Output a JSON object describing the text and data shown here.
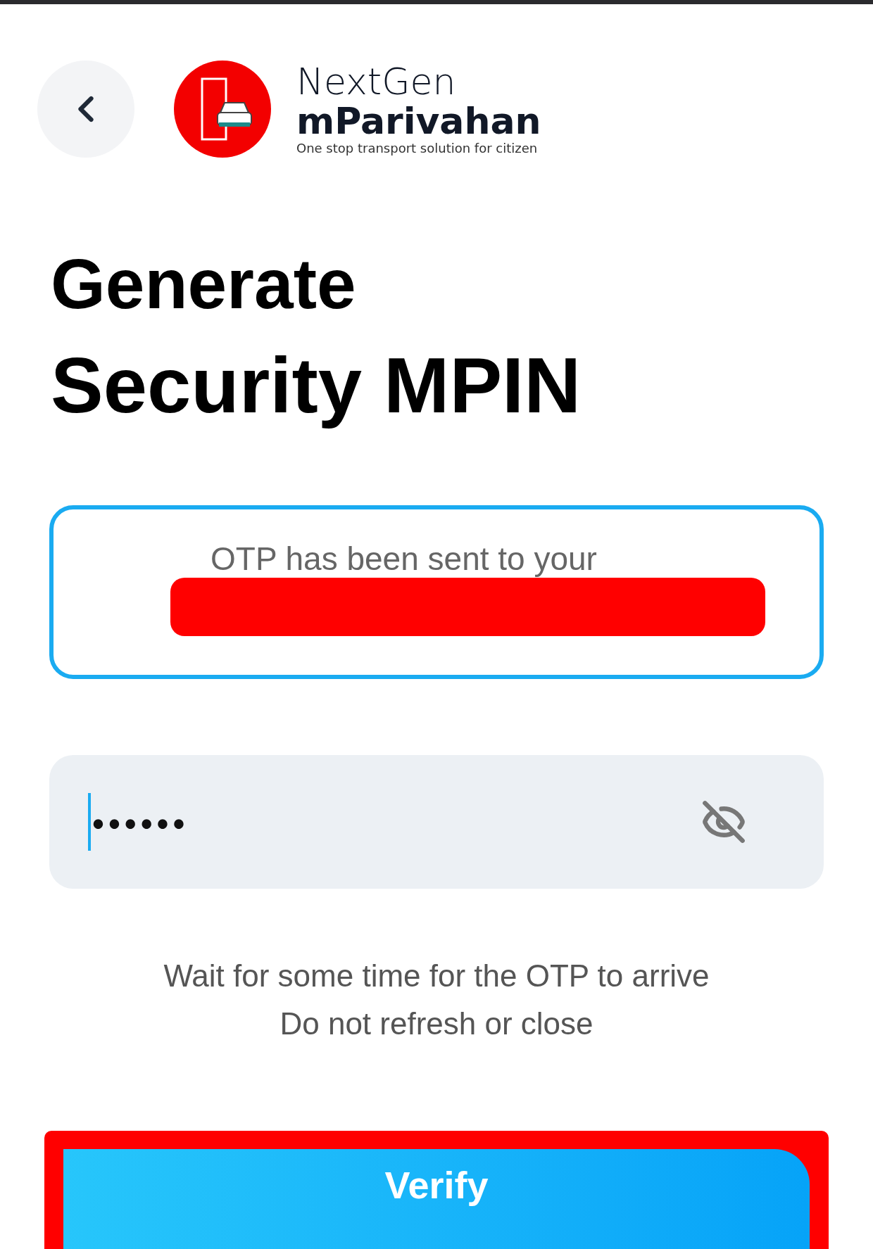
{
  "header": {
    "brand_line1": "NextGen",
    "brand_line2": "mParivahan",
    "tagline": "One stop transport solution for citizen"
  },
  "title_line1": "Generate",
  "title_line2": "Security MPIN",
  "message_box": {
    "text": "OTP has been sent to your"
  },
  "otp_field": {
    "value": "••••••"
  },
  "hints": [
    "Wait for some time for the OTP to arrive",
    "Do not refresh or close"
  ],
  "verify_button": {
    "label": "Verify"
  }
}
